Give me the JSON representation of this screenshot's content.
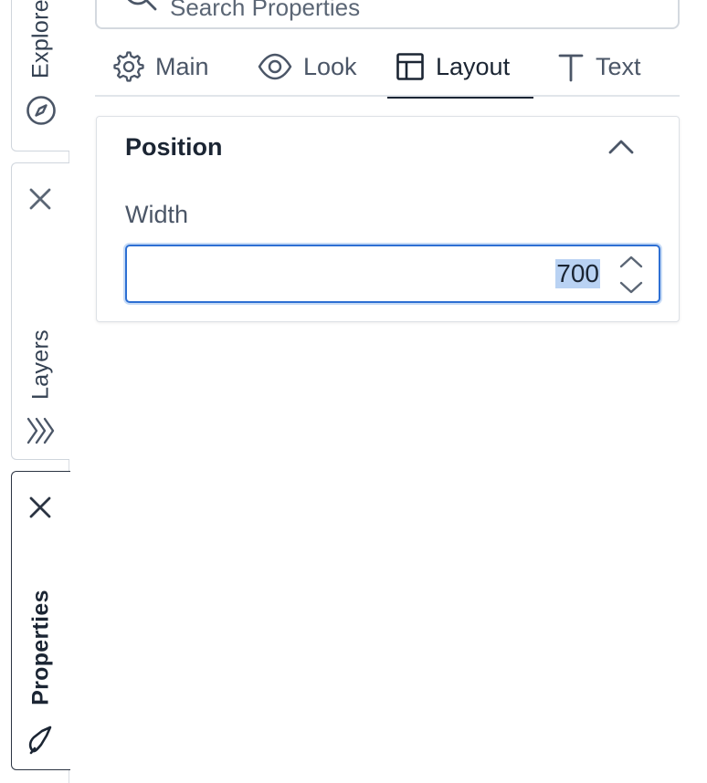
{
  "rail": {
    "explore_label": "Explore",
    "layers_label": "Layers",
    "properties_label": "Properties",
    "icons": {
      "explore": "compass-icon",
      "layers": "layers-chevrons-icon",
      "properties": "drop-pen-icon",
      "close": "close-icon"
    }
  },
  "search": {
    "placeholder": "Search Properties",
    "icon": "search-icon"
  },
  "tabs": [
    {
      "label": "Main",
      "icon": "gear-icon",
      "active": false
    },
    {
      "label": "Look",
      "icon": "eye-icon",
      "active": false
    },
    {
      "label": "Layout",
      "icon": "layout-icon",
      "active": true
    },
    {
      "label": "Text",
      "icon": "text-t-icon",
      "active": false
    }
  ],
  "section": {
    "title": "Position",
    "collapse_icon": "chevron-up-icon",
    "fields": [
      {
        "label": "Width",
        "value": "700"
      }
    ]
  },
  "colors": {
    "accent": "#2d6fd3",
    "selection": "#b9d2f3",
    "text_dark": "#1b2533",
    "text_muted": "#4b5667",
    "border": "#d4d9df"
  }
}
